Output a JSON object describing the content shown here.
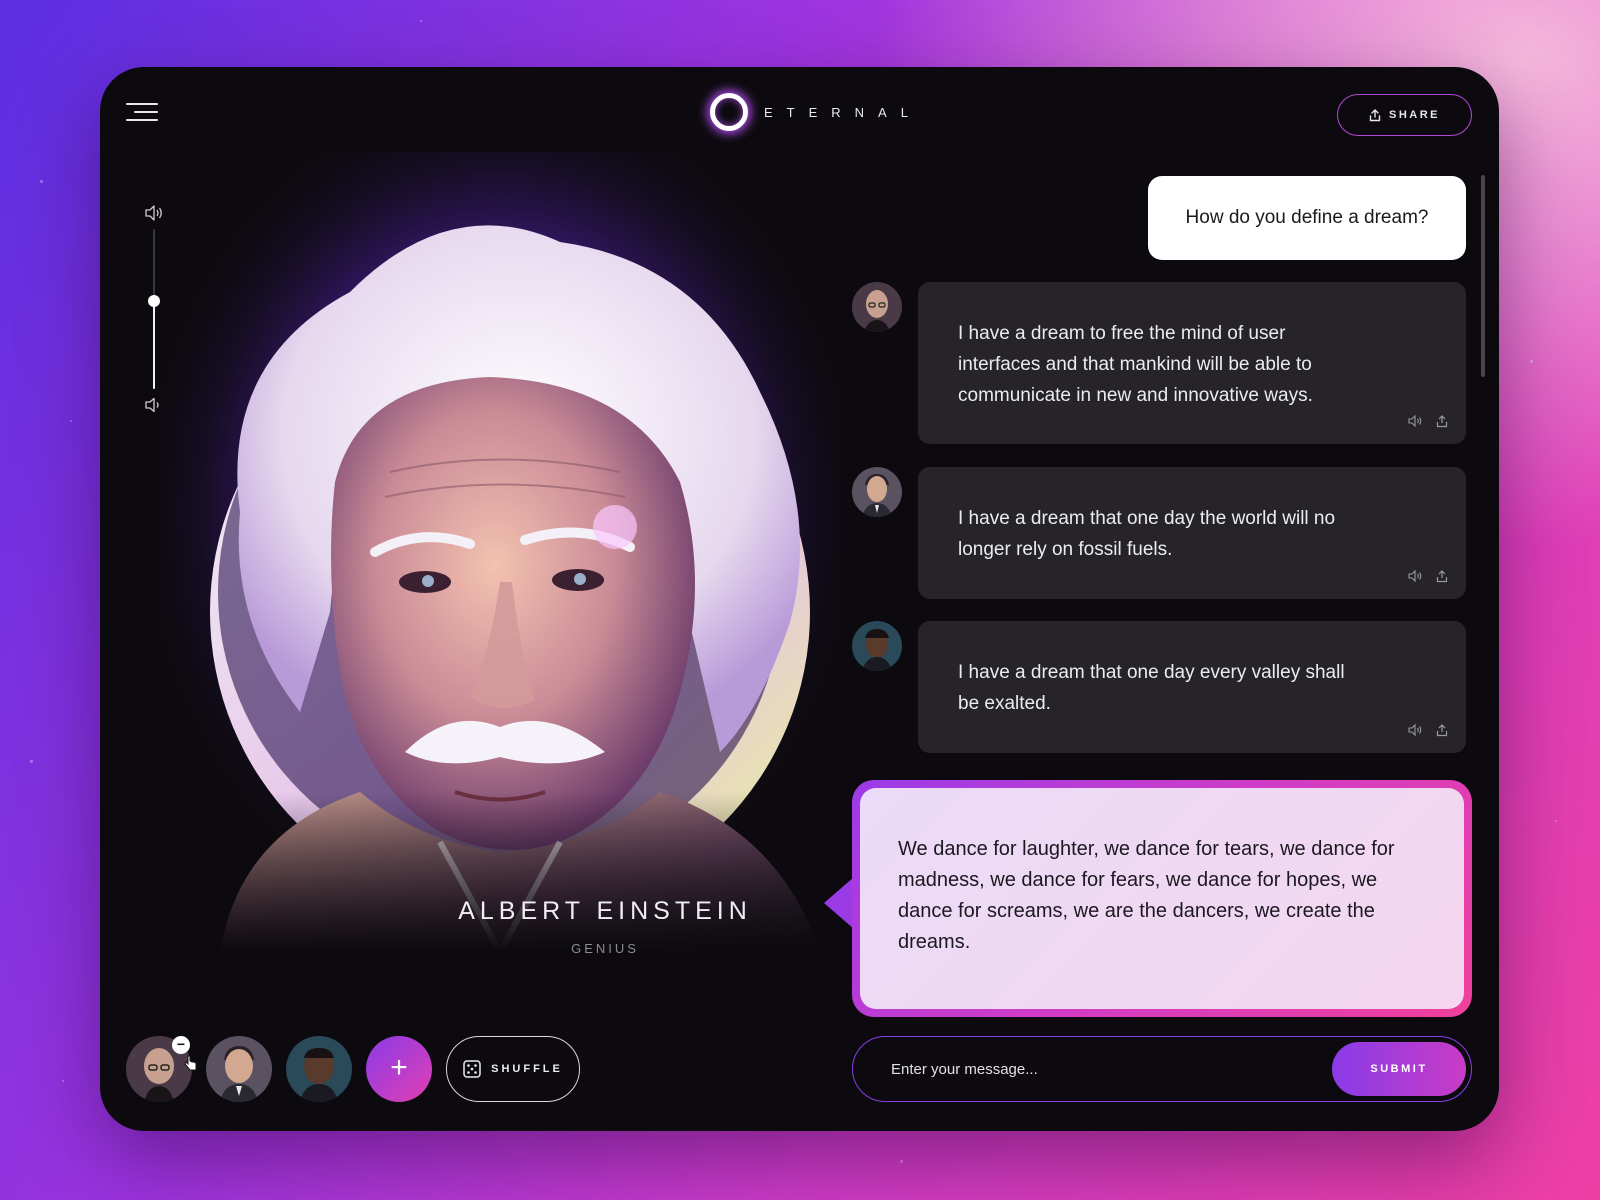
{
  "app": {
    "brand": "ETERNAL",
    "menu_icon": "hamburger-menu-icon",
    "share_label": "SHARE"
  },
  "volume": {
    "level": 0.55,
    "up_icon": "volume-up-icon",
    "down_icon": "volume-down-icon"
  },
  "persona": {
    "name": "ALBERT EINSTEIN",
    "role": "GENIUS"
  },
  "chat": {
    "user_question": "How do you define a dream?",
    "messages": [
      {
        "avatar": "avatar-steve-jobs",
        "text": "I have a dream to free the mind of user interfaces and that mankind will be able to communicate in new and innovative ways."
      },
      {
        "avatar": "avatar-elon-musk",
        "text": "I have a dream that one day the world will no longer rely on fossil fuels."
      },
      {
        "avatar": "avatar-martin-luther-king",
        "text": "I have a dream that one day every valley shall be exalted."
      }
    ],
    "highlight_answer": "We dance for laughter, we dance for tears, we dance for madness, we dance for fears, we dance for hopes, we dance for screams, we are the dancers, we create the dreams."
  },
  "composer": {
    "placeholder": "Enter your message...",
    "submit_label": "SUBMIT"
  },
  "bottom_bar": {
    "avatars": [
      "avatar-steve-jobs",
      "avatar-elon-musk",
      "avatar-martin-luther-king"
    ],
    "add_label": "+",
    "shuffle_label": "SHUFFLE",
    "remove_label": "−"
  },
  "colors": {
    "accent_start": "#8a3be8",
    "accent_end": "#f0409b",
    "panel_bg": "#0c0a0e",
    "card_bg": "#262428"
  }
}
